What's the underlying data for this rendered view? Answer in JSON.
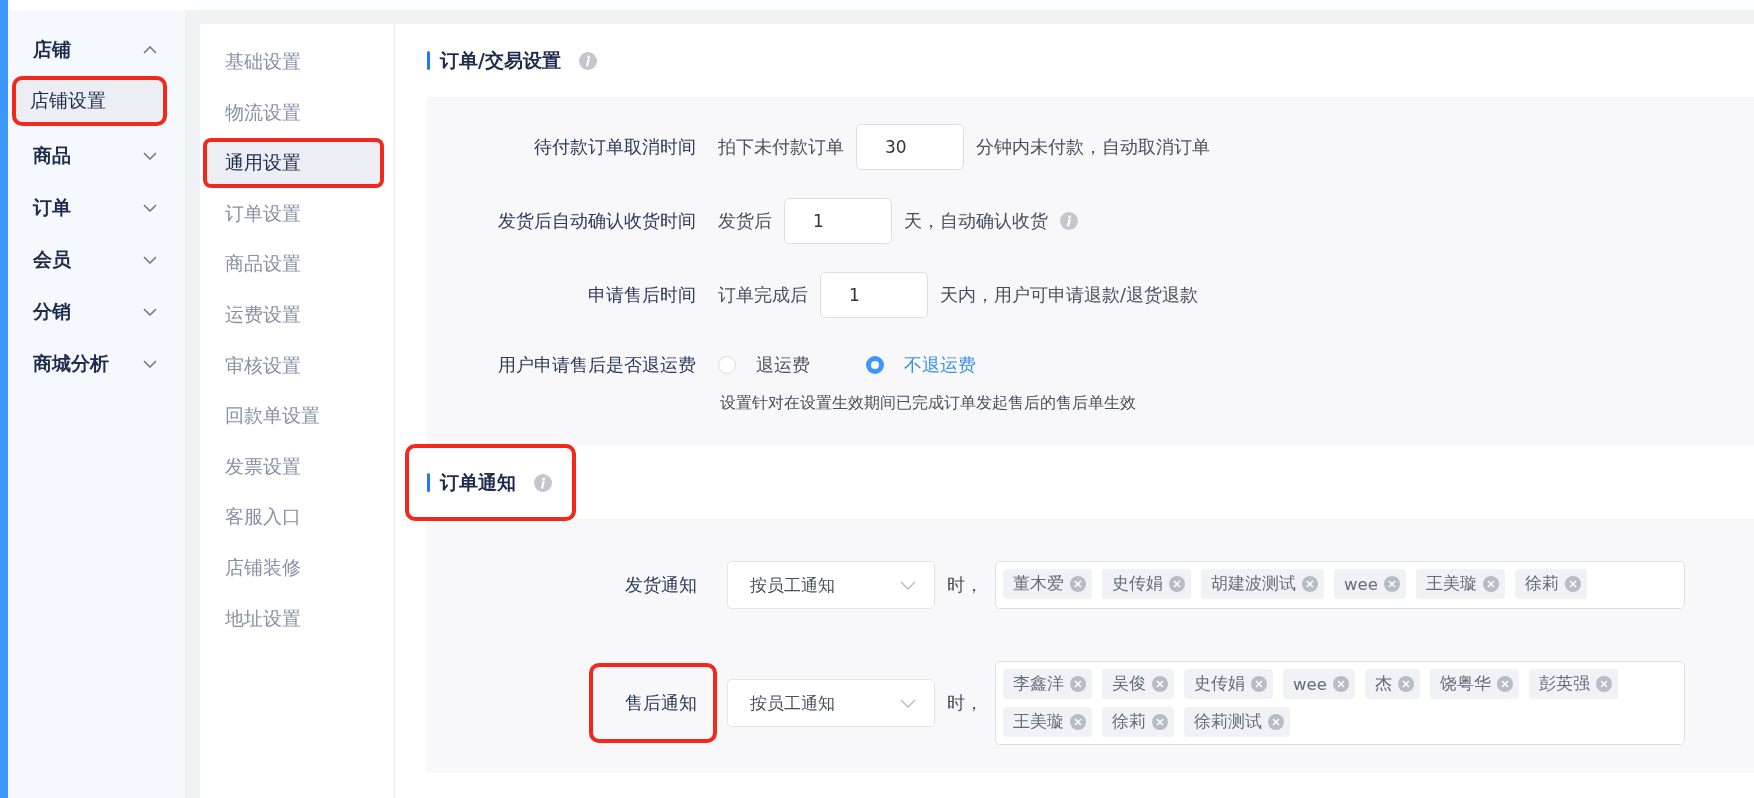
{
  "sidebar": {
    "groups": [
      {
        "label": "店铺",
        "expanded": true,
        "children": [
          {
            "label": "店铺设置",
            "selected": true,
            "annotated": true
          }
        ]
      },
      {
        "label": "商品",
        "expanded": false
      },
      {
        "label": "订单",
        "expanded": false
      },
      {
        "label": "会员",
        "expanded": false
      },
      {
        "label": "分销",
        "expanded": false
      },
      {
        "label": "商城分析",
        "expanded": false
      }
    ]
  },
  "submenu": {
    "items": [
      {
        "label": "基础设置",
        "selected": false,
        "annotated": false
      },
      {
        "label": "物流设置",
        "selected": false,
        "annotated": false
      },
      {
        "label": "通用设置",
        "selected": true,
        "annotated": true
      },
      {
        "label": "订单设置",
        "selected": false,
        "annotated": false
      },
      {
        "label": "商品设置",
        "selected": false,
        "annotated": false
      },
      {
        "label": "运费设置",
        "selected": false,
        "annotated": false
      },
      {
        "label": "审核设置",
        "selected": false,
        "annotated": false
      },
      {
        "label": "回款单设置",
        "selected": false,
        "annotated": false
      },
      {
        "label": "发票设置",
        "selected": false,
        "annotated": false
      },
      {
        "label": "客服入口",
        "selected": false,
        "annotated": false
      },
      {
        "label": "店铺装修",
        "selected": false,
        "annotated": false
      },
      {
        "label": "地址设置",
        "selected": false,
        "annotated": false
      }
    ]
  },
  "sections": [
    {
      "title": "订单/交易设置",
      "annotated": false,
      "rows": [
        {
          "kind": "input",
          "label": "待付款订单取消时间",
          "prefix": "拍下未付款订单",
          "value": "30",
          "suffix": "分钟内未付款，自动取消订单",
          "info": false
        },
        {
          "kind": "input",
          "label": "发货后自动确认收货时间",
          "prefix": "发货后",
          "value": "1",
          "suffix": "天，自动确认收货",
          "info": true
        },
        {
          "kind": "input",
          "label": "申请售后时间",
          "prefix": "订单完成后",
          "value": "1",
          "suffix": "天内，用户可申请退款/退货退款",
          "info": false
        },
        {
          "kind": "radio",
          "label": "用户申请售后是否退运费",
          "options": [
            {
              "label": "退运费",
              "selected": false
            },
            {
              "label": "不退运费",
              "selected": true
            }
          ],
          "hint": "设置针对在设置生效期间已完成订单发起售后的售后单生效"
        }
      ]
    },
    {
      "title": "订单通知",
      "annotated": true,
      "rows": [
        {
          "kind": "notify",
          "label": "发货通知",
          "annotated": false,
          "select": "按员工通知",
          "suffix": "时，",
          "tags": [
            "董木爱",
            "史传娟",
            "胡建波测试",
            "wee",
            "王美璇",
            "徐莉"
          ]
        },
        {
          "kind": "notify",
          "label": "售后通知",
          "annotated": true,
          "select": "按员工通知",
          "suffix": "时，",
          "tags": [
            "李鑫洋",
            "吴俊",
            "史传娟",
            "wee",
            "杰",
            "饶粤华",
            "彭英强",
            "王美璇",
            "徐莉",
            "徐莉测试"
          ]
        }
      ]
    }
  ]
}
